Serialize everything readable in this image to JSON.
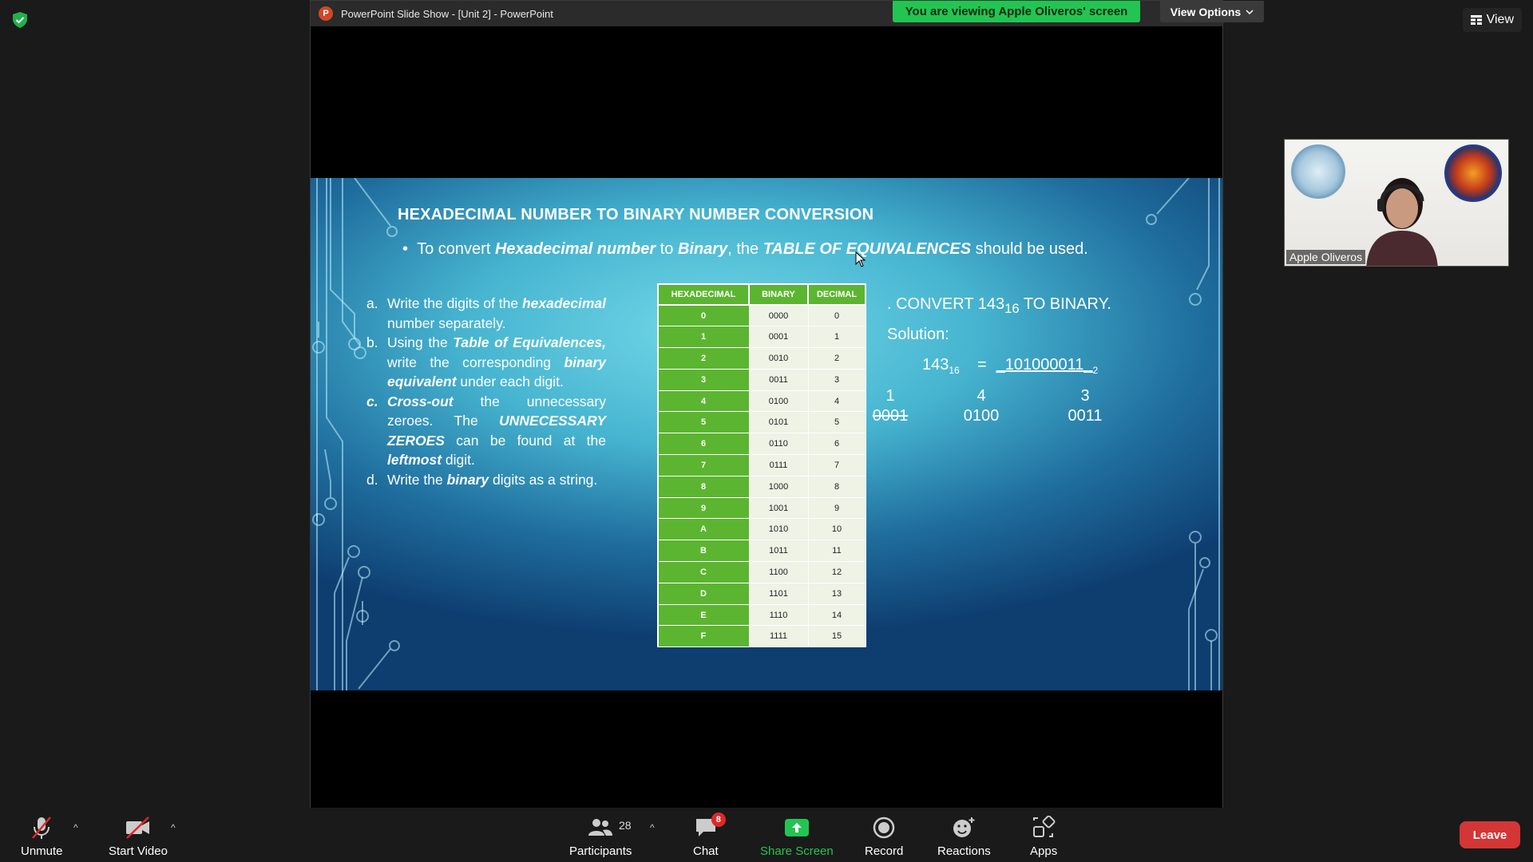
{
  "window": {
    "title": "PowerPoint Slide Show - [Unit 2] - PowerPoint"
  },
  "banner": {
    "viewing_text": "You are viewing Apple Oliveros' screen",
    "view_options_label": "View Options"
  },
  "top_right": {
    "view_label": "View"
  },
  "slide": {
    "title": "HEXADECIMAL NUMBER TO BINARY NUMBER CONVERSION",
    "bullet": {
      "pre": "To convert ",
      "em1": "Hexadecimal number",
      "mid1": " to ",
      "em2": "Binary",
      "mid2": ", the ",
      "em3": "TABLE OF EQUIVALENCES",
      "post": " should be used."
    },
    "steps": [
      {
        "marker": "a.",
        "parts": [
          "Write the digits of the ",
          "hexadecimal",
          " number separately."
        ]
      },
      {
        "marker": "b.",
        "parts": [
          "Using the ",
          "Table of Equivalences,",
          " write the corresponding ",
          "binary equivalent",
          " under each digit."
        ]
      },
      {
        "marker": "c.",
        "parts": [
          "Cross-out",
          " the unnecessary zeroes. The ",
          "UNNECESSARY ZEROES",
          " can be found at the ",
          "leftmost",
          " digit."
        ]
      },
      {
        "marker": "d.",
        "parts": [
          "Write the ",
          "binary",
          " digits as a string."
        ]
      }
    ],
    "table": {
      "headers": [
        "HEXADECIMAL",
        "BINARY",
        "DECIMAL"
      ],
      "rows": [
        [
          "0",
          "0000",
          "0"
        ],
        [
          "1",
          "0001",
          "1"
        ],
        [
          "2",
          "0010",
          "2"
        ],
        [
          "3",
          "0011",
          "3"
        ],
        [
          "4",
          "0100",
          "4"
        ],
        [
          "5",
          "0101",
          "5"
        ],
        [
          "6",
          "0110",
          "6"
        ],
        [
          "7",
          "0111",
          "7"
        ],
        [
          "8",
          "1000",
          "8"
        ],
        [
          "9",
          "1001",
          "9"
        ],
        [
          "A",
          "1010",
          "10"
        ],
        [
          "B",
          "1011",
          "11"
        ],
        [
          "C",
          "1100",
          "12"
        ],
        [
          "D",
          "1101",
          "13"
        ],
        [
          "E",
          "1110",
          "14"
        ],
        [
          "F",
          "1111",
          "15"
        ]
      ]
    },
    "convert": {
      "prefix": ". CONVERT 143",
      "sub": "16",
      "suffix": " TO BINARY."
    },
    "solution_label": "Solution:",
    "equation": {
      "lhs": "143",
      "lhs_sub": "16",
      "equals": "=",
      "result": "_101000011_",
      "result_sub": "2"
    },
    "digits": [
      "1",
      "4",
      "3"
    ],
    "binaries": [
      "0001",
      "0100",
      "0011"
    ]
  },
  "participant": {
    "name": "Apple Oliveros"
  },
  "toolbar": {
    "unmute": "Unmute",
    "start_video": "Start Video",
    "participants": "Participants",
    "participants_count": "28",
    "chat": "Chat",
    "chat_badge": "8",
    "share_screen": "Share Screen",
    "record": "Record",
    "reactions": "Reactions",
    "apps": "Apps",
    "leave": "Leave"
  },
  "colors": {
    "share_green": "#23c552",
    "table_green": "#5cb531",
    "leave_red": "#d43535"
  }
}
